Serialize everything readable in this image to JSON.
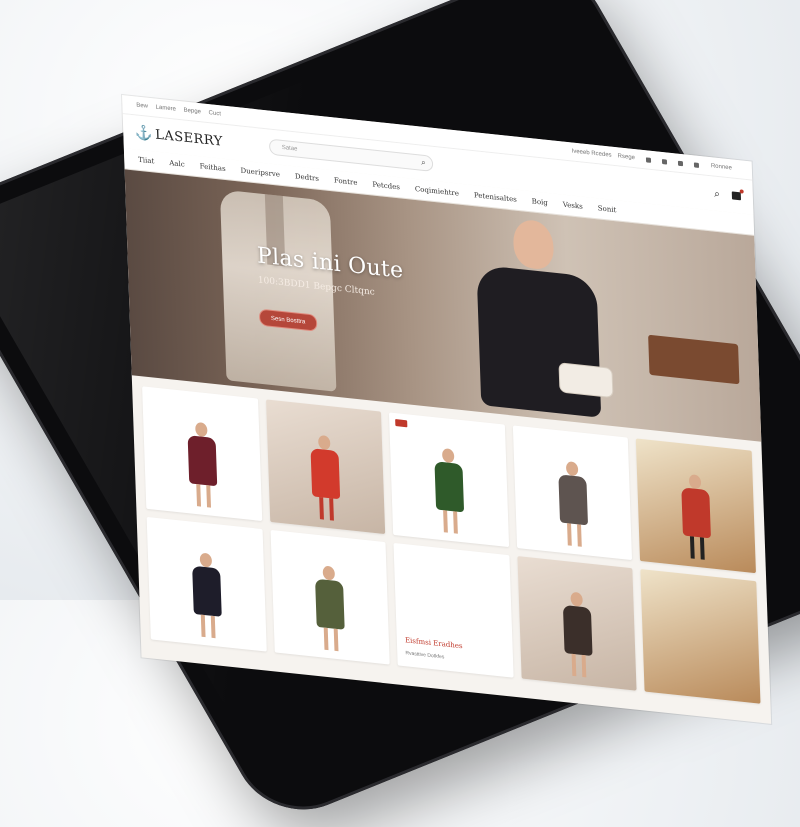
{
  "topbar": {
    "links": [
      "Bew",
      "Lamere",
      "Bepge",
      "Cuct"
    ],
    "right_links": [
      "Iveeeb Rcedes",
      "Rsege"
    ],
    "utility": "Ronnee"
  },
  "header": {
    "logo_text": "LASERRY",
    "search_placeholder": "Satae",
    "icons": [
      "search-icon",
      "cart-icon"
    ]
  },
  "nav": {
    "items": [
      "Tiiat",
      "Aalc",
      "Feithas",
      "Dueripsrve",
      "Dedtrs",
      "Fontre",
      "Petcdes",
      "Coqimiehtre",
      "Petenisaltes",
      "Boig",
      "Vesks",
      "Sonit"
    ]
  },
  "hero": {
    "title": "Plas ini Oute",
    "subtitle": "100:3BDD1 Bepgc Cltqnc",
    "cta_label": "Sesn Bosttra"
  },
  "products": {
    "promo_title": "Eisfmsi Eradhes",
    "promo_sub": "Rvasttive Dotkfes"
  },
  "colors": {
    "accent": "#b5473a",
    "logo_mark": "#c9a227",
    "tablet_frame": "#0c0c0e"
  }
}
